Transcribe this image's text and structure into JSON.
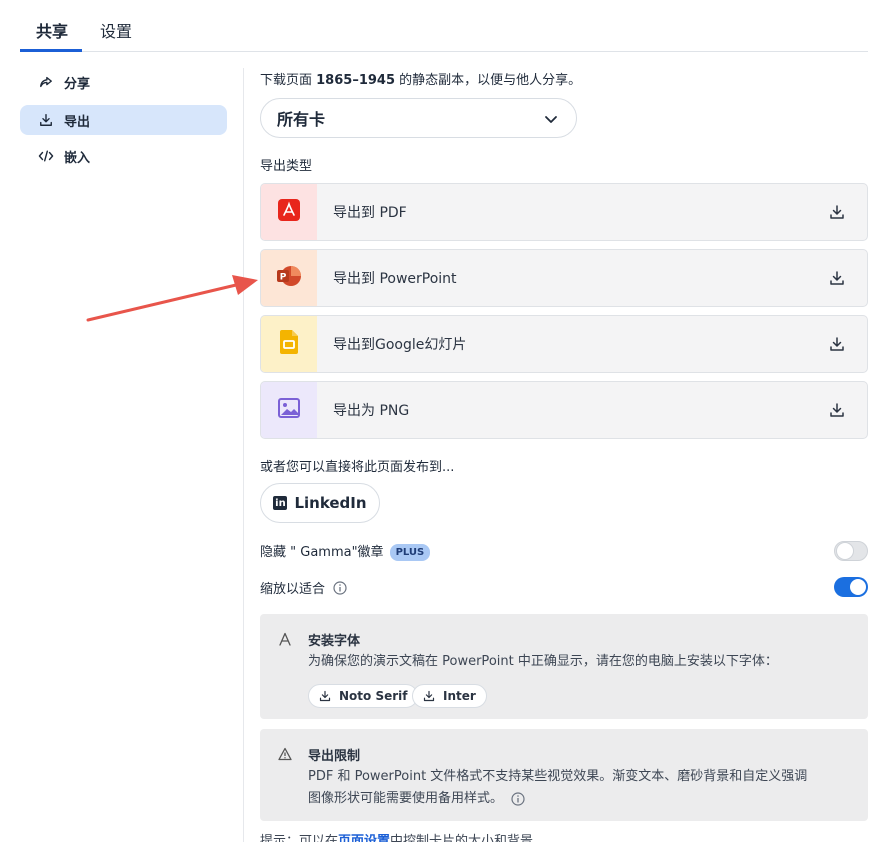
{
  "tabs": [
    {
      "label": "共享"
    },
    {
      "label": "设置"
    }
  ],
  "sidebar": {
    "items": [
      {
        "label": "分享",
        "icon": "share-icon"
      },
      {
        "label": "导出",
        "icon": "download-icon"
      },
      {
        "label": "嵌入",
        "icon": "code-icon"
      }
    ]
  },
  "main": {
    "intro_prefix": "下载页面 ",
    "intro_pages": "1865–1945",
    "intro_suffix": " 的静态副本，以便与他人分享。",
    "card_select": {
      "value": "所有卡"
    },
    "export_type_label": "导出类型",
    "exports": [
      {
        "label": "导出到 PDF",
        "icon": "pdf-icon"
      },
      {
        "label": "导出到 PowerPoint",
        "icon": "powerpoint-icon"
      },
      {
        "label": "导出到Google幻灯片",
        "icon": "google-slides-icon"
      },
      {
        "label": "导出为 PNG",
        "icon": "image-icon"
      }
    ],
    "publish_label": "或者您可以直接将此页面发布到...",
    "linkedin_label": "LinkedIn",
    "hide_badge_label": "隐藏 \" Gamma\"徽章",
    "plus_badge": "PLUS",
    "fit_label": "缩放以适合",
    "fonts_card": {
      "title": "安装字体",
      "desc": "为确保您的演示文稿在 PowerPoint 中正确显示，请在您的电脑上安装以下字体：",
      "fonts": [
        "Noto Serif",
        "Inter"
      ]
    },
    "limits_card": {
      "title": "导出限制",
      "desc_line1": "PDF 和 PowerPoint 文件格式不支持某些视觉效果。渐变文本、磨砂背景和自定义强调",
      "desc_line2": "图像形状可能需要使用备用样式。"
    },
    "hint_prefix": "提示：可以在",
    "hint_link": "页面设置",
    "hint_suffix": "中控制卡片的大小和背景"
  },
  "toggles": {
    "hide_badge": false,
    "fit": true
  },
  "colors": {
    "accent": "#1b6fe0",
    "pdf": "#e8261c",
    "powerpoint": "#d2492a",
    "google_slides": "#f4b400",
    "png": "#7b61d6",
    "annotation_arrow": "#e8554b"
  }
}
